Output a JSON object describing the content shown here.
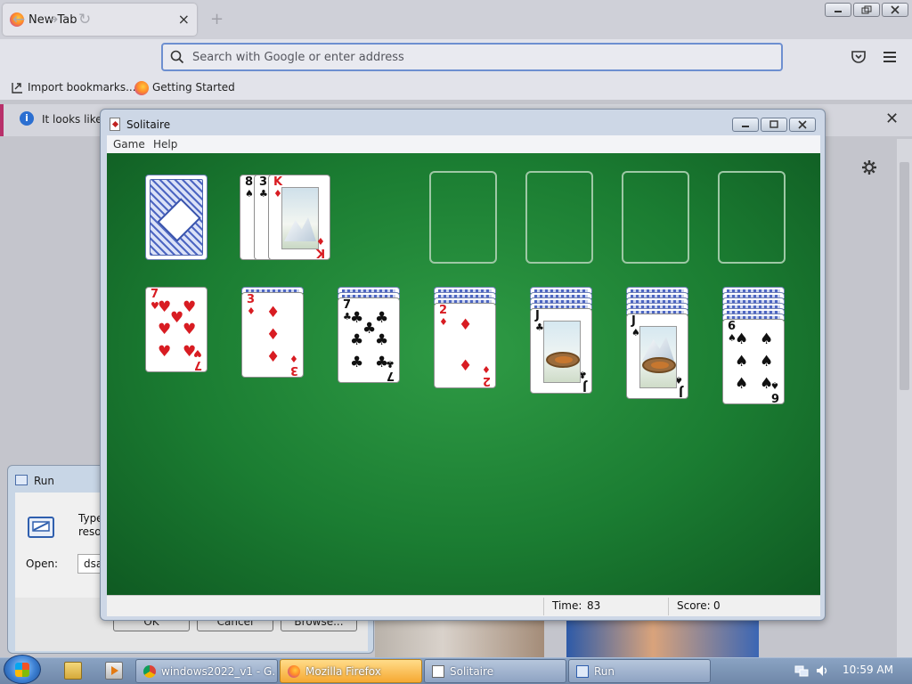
{
  "browser": {
    "tab_title": "New Tab",
    "tab_close": "×",
    "new_tab": "+",
    "back": "←",
    "forward": "→",
    "reload": "↻",
    "url_placeholder": "Search with Google or enter address",
    "bookmarks": [
      "Import bookmarks...",
      "Getting Started"
    ],
    "infobar_text": "It looks like y",
    "infobar_close": "✕"
  },
  "run_dialog": {
    "title": "Run",
    "desc_line1": "Type t",
    "desc_line2": "resour",
    "open_label": "Open:",
    "open_value": "dsada",
    "buttons": [
      "OK",
      "Cancel",
      "Browse..."
    ]
  },
  "solitaire": {
    "title": "Solitaire",
    "menu": [
      "Game",
      "Help"
    ],
    "waste": [
      {
        "rank": "8",
        "suit": "♠"
      },
      {
        "rank": "3",
        "suit": "♣"
      },
      {
        "rank": "K",
        "suit": "♦"
      }
    ],
    "tableau": [
      {
        "rank": "7",
        "suit": "♥",
        "hidden": 0
      },
      {
        "rank": "3",
        "suit": "♦",
        "hidden": 1
      },
      {
        "rank": "7",
        "suit": "♣",
        "hidden": 2
      },
      {
        "rank": "2",
        "suit": "♦",
        "hidden": 3
      },
      {
        "rank": "J",
        "suit": "♣",
        "hidden": 4
      },
      {
        "rank": "J",
        "suit": "♠",
        "hidden": 5
      },
      {
        "rank": "6",
        "suit": "♠",
        "hidden": 6
      }
    ],
    "time_label": "Time:",
    "time_value": "83",
    "score_label": "Score:",
    "score_value": "0"
  },
  "taskbar": {
    "items": [
      "windows2022_v1 - G...",
      "Mozilla Firefox",
      "Solitaire",
      "Run"
    ],
    "clock": "10:59 AM"
  },
  "colors": {
    "felt": "#1b7d32",
    "red_suit": "#d81c22",
    "taskbar": "#7f97b8"
  }
}
